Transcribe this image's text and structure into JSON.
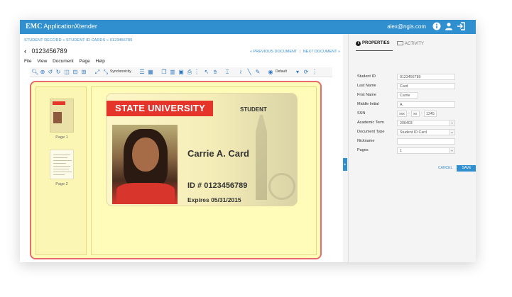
{
  "topbar": {
    "brand_emc": "EMC",
    "brand_app": "ApplicationXtender",
    "user_email": "alex@ngis.com",
    "icons": [
      "info-icon",
      "user-icon",
      "logout-icon"
    ]
  },
  "header": {
    "breadcrumb": "STUDENT RECORD » STUDENT ID CARDS » 0123456789",
    "back_glyph": "‹",
    "doc_title": "0123456789",
    "prev_doc": "« PREVIOUS DOCUMENT",
    "divider": "|",
    "next_doc": "NEXT DOCUMENT »"
  },
  "menu": [
    "File",
    "View",
    "Document",
    "Page",
    "Help"
  ],
  "toolbar": {
    "synchronicity_label": "Synchronicity",
    "default_label": "Default"
  },
  "thumbnails": [
    {
      "label": "Page 1"
    },
    {
      "label": "Page 2"
    }
  ],
  "card": {
    "university": "STATE UNIVERSITY",
    "student_label": "STUDENT",
    "name": "Carrie A. Card",
    "id_line": "ID # 0123456789",
    "expires_line": "Expires 05/31/2015"
  },
  "panel": {
    "tab_properties": "PROPERTIES",
    "tab_activity": "ACTIVITY",
    "fields": [
      {
        "label": "Student ID",
        "value": "0123456789"
      },
      {
        "label": "Last Name",
        "value": "Card"
      },
      {
        "label": "First Name",
        "value": "Carrie"
      },
      {
        "label": "Middle Initial",
        "value": "A."
      },
      {
        "label": "SSN",
        "value": ""
      },
      {
        "label": "Academic Term",
        "value": "200403"
      },
      {
        "label": "Document Type",
        "value": "Student ID Card"
      },
      {
        "label": "Nickname",
        "value": ""
      },
      {
        "label": "Pages",
        "value": "1"
      }
    ],
    "ssn_parts": [
      "xxx",
      "xx",
      "1245"
    ],
    "cancel_label": "CANCEL",
    "save_label": "SAVE"
  },
  "colors": {
    "accent": "#2f8fcf",
    "viewer_bg": "#fffbb8",
    "highlight_border": "#e96b6b",
    "card_banner": "#e5342a"
  }
}
